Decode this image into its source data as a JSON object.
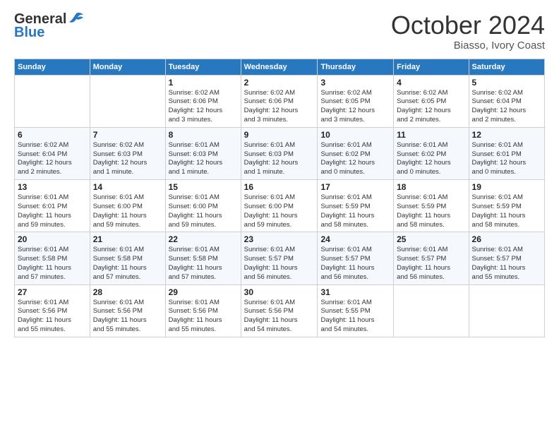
{
  "logo": {
    "line1": "General",
    "line2": "Blue"
  },
  "title": "October 2024",
  "subtitle": "Biasso, Ivory Coast",
  "weekdays": [
    "Sunday",
    "Monday",
    "Tuesday",
    "Wednesday",
    "Thursday",
    "Friday",
    "Saturday"
  ],
  "weeks": [
    [
      {
        "day": "",
        "info": ""
      },
      {
        "day": "",
        "info": ""
      },
      {
        "day": "1",
        "info": "Sunrise: 6:02 AM\nSunset: 6:06 PM\nDaylight: 12 hours\nand 3 minutes."
      },
      {
        "day": "2",
        "info": "Sunrise: 6:02 AM\nSunset: 6:06 PM\nDaylight: 12 hours\nand 3 minutes."
      },
      {
        "day": "3",
        "info": "Sunrise: 6:02 AM\nSunset: 6:05 PM\nDaylight: 12 hours\nand 3 minutes."
      },
      {
        "day": "4",
        "info": "Sunrise: 6:02 AM\nSunset: 6:05 PM\nDaylight: 12 hours\nand 2 minutes."
      },
      {
        "day": "5",
        "info": "Sunrise: 6:02 AM\nSunset: 6:04 PM\nDaylight: 12 hours\nand 2 minutes."
      }
    ],
    [
      {
        "day": "6",
        "info": "Sunrise: 6:02 AM\nSunset: 6:04 PM\nDaylight: 12 hours\nand 2 minutes."
      },
      {
        "day": "7",
        "info": "Sunrise: 6:02 AM\nSunset: 6:03 PM\nDaylight: 12 hours\nand 1 minute."
      },
      {
        "day": "8",
        "info": "Sunrise: 6:01 AM\nSunset: 6:03 PM\nDaylight: 12 hours\nand 1 minute."
      },
      {
        "day": "9",
        "info": "Sunrise: 6:01 AM\nSunset: 6:03 PM\nDaylight: 12 hours\nand 1 minute."
      },
      {
        "day": "10",
        "info": "Sunrise: 6:01 AM\nSunset: 6:02 PM\nDaylight: 12 hours\nand 0 minutes."
      },
      {
        "day": "11",
        "info": "Sunrise: 6:01 AM\nSunset: 6:02 PM\nDaylight: 12 hours\nand 0 minutes."
      },
      {
        "day": "12",
        "info": "Sunrise: 6:01 AM\nSunset: 6:01 PM\nDaylight: 12 hours\nand 0 minutes."
      }
    ],
    [
      {
        "day": "13",
        "info": "Sunrise: 6:01 AM\nSunset: 6:01 PM\nDaylight: 11 hours\nand 59 minutes."
      },
      {
        "day": "14",
        "info": "Sunrise: 6:01 AM\nSunset: 6:00 PM\nDaylight: 11 hours\nand 59 minutes."
      },
      {
        "day": "15",
        "info": "Sunrise: 6:01 AM\nSunset: 6:00 PM\nDaylight: 11 hours\nand 59 minutes."
      },
      {
        "day": "16",
        "info": "Sunrise: 6:01 AM\nSunset: 6:00 PM\nDaylight: 11 hours\nand 59 minutes."
      },
      {
        "day": "17",
        "info": "Sunrise: 6:01 AM\nSunset: 5:59 PM\nDaylight: 11 hours\nand 58 minutes."
      },
      {
        "day": "18",
        "info": "Sunrise: 6:01 AM\nSunset: 5:59 PM\nDaylight: 11 hours\nand 58 minutes."
      },
      {
        "day": "19",
        "info": "Sunrise: 6:01 AM\nSunset: 5:59 PM\nDaylight: 11 hours\nand 58 minutes."
      }
    ],
    [
      {
        "day": "20",
        "info": "Sunrise: 6:01 AM\nSunset: 5:58 PM\nDaylight: 11 hours\nand 57 minutes."
      },
      {
        "day": "21",
        "info": "Sunrise: 6:01 AM\nSunset: 5:58 PM\nDaylight: 11 hours\nand 57 minutes."
      },
      {
        "day": "22",
        "info": "Sunrise: 6:01 AM\nSunset: 5:58 PM\nDaylight: 11 hours\nand 57 minutes."
      },
      {
        "day": "23",
        "info": "Sunrise: 6:01 AM\nSunset: 5:57 PM\nDaylight: 11 hours\nand 56 minutes."
      },
      {
        "day": "24",
        "info": "Sunrise: 6:01 AM\nSunset: 5:57 PM\nDaylight: 11 hours\nand 56 minutes."
      },
      {
        "day": "25",
        "info": "Sunrise: 6:01 AM\nSunset: 5:57 PM\nDaylight: 11 hours\nand 56 minutes."
      },
      {
        "day": "26",
        "info": "Sunrise: 6:01 AM\nSunset: 5:57 PM\nDaylight: 11 hours\nand 55 minutes."
      }
    ],
    [
      {
        "day": "27",
        "info": "Sunrise: 6:01 AM\nSunset: 5:56 PM\nDaylight: 11 hours\nand 55 minutes."
      },
      {
        "day": "28",
        "info": "Sunrise: 6:01 AM\nSunset: 5:56 PM\nDaylight: 11 hours\nand 55 minutes."
      },
      {
        "day": "29",
        "info": "Sunrise: 6:01 AM\nSunset: 5:56 PM\nDaylight: 11 hours\nand 55 minutes."
      },
      {
        "day": "30",
        "info": "Sunrise: 6:01 AM\nSunset: 5:56 PM\nDaylight: 11 hours\nand 54 minutes."
      },
      {
        "day": "31",
        "info": "Sunrise: 6:01 AM\nSunset: 5:55 PM\nDaylight: 11 hours\nand 54 minutes."
      },
      {
        "day": "",
        "info": ""
      },
      {
        "day": "",
        "info": ""
      }
    ]
  ]
}
